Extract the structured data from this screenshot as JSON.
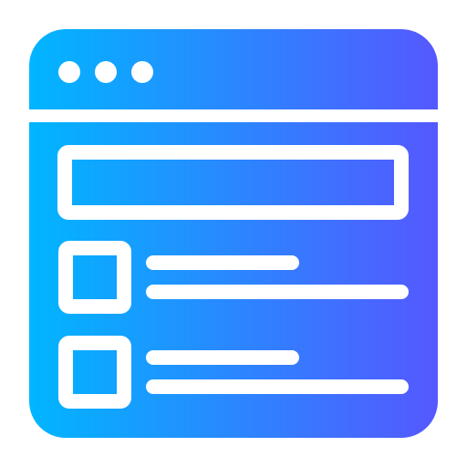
{
  "icon": {
    "name": "browser-window-list-icon",
    "gradient_start": "#00B6FF",
    "gradient_end": "#5558FF",
    "foreground": "#FFFFFF",
    "background": "#FFFFFF"
  }
}
